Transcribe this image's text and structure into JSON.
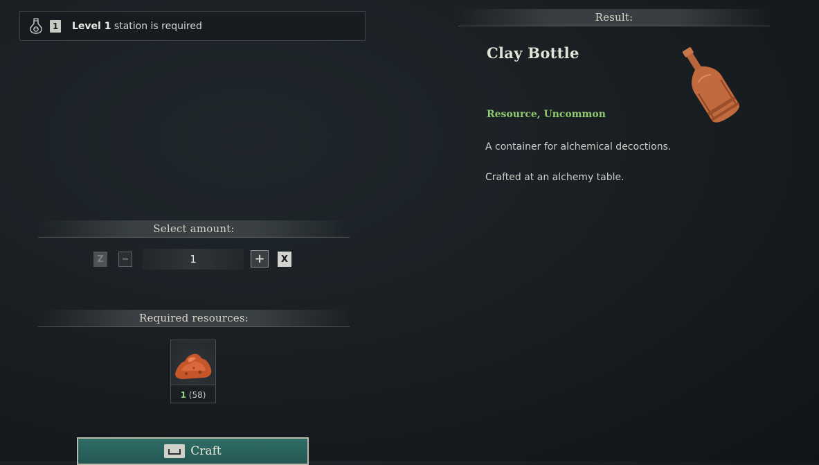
{
  "station": {
    "icon": "alchemy-flask-icon",
    "level_badge": "1",
    "level_text": "Level 1",
    "suffix_text": "station is required"
  },
  "amount": {
    "header": "Select amount:",
    "decrease_key": "Z",
    "decrease_symbol": "−",
    "value": "1",
    "increase_symbol": "+",
    "increase_key": "X"
  },
  "resources": {
    "header": "Required resources:",
    "items": [
      {
        "icon": "clay-resource-icon",
        "required": "1",
        "owned": "(58)"
      }
    ]
  },
  "craft": {
    "key_icon": "spacebar-key-icon",
    "label": "Craft"
  },
  "result": {
    "header": "Result:",
    "name": "Clay Bottle",
    "icon": "clay-bottle-icon",
    "category": "Resource, Uncommon",
    "description": "A container for alchemical decoctions.",
    "source": "Crafted at an alchemy table."
  },
  "colors": {
    "rarity": "#8fc86e",
    "craft_button": "#2f6c66",
    "resource_have": "#8fd17a"
  }
}
